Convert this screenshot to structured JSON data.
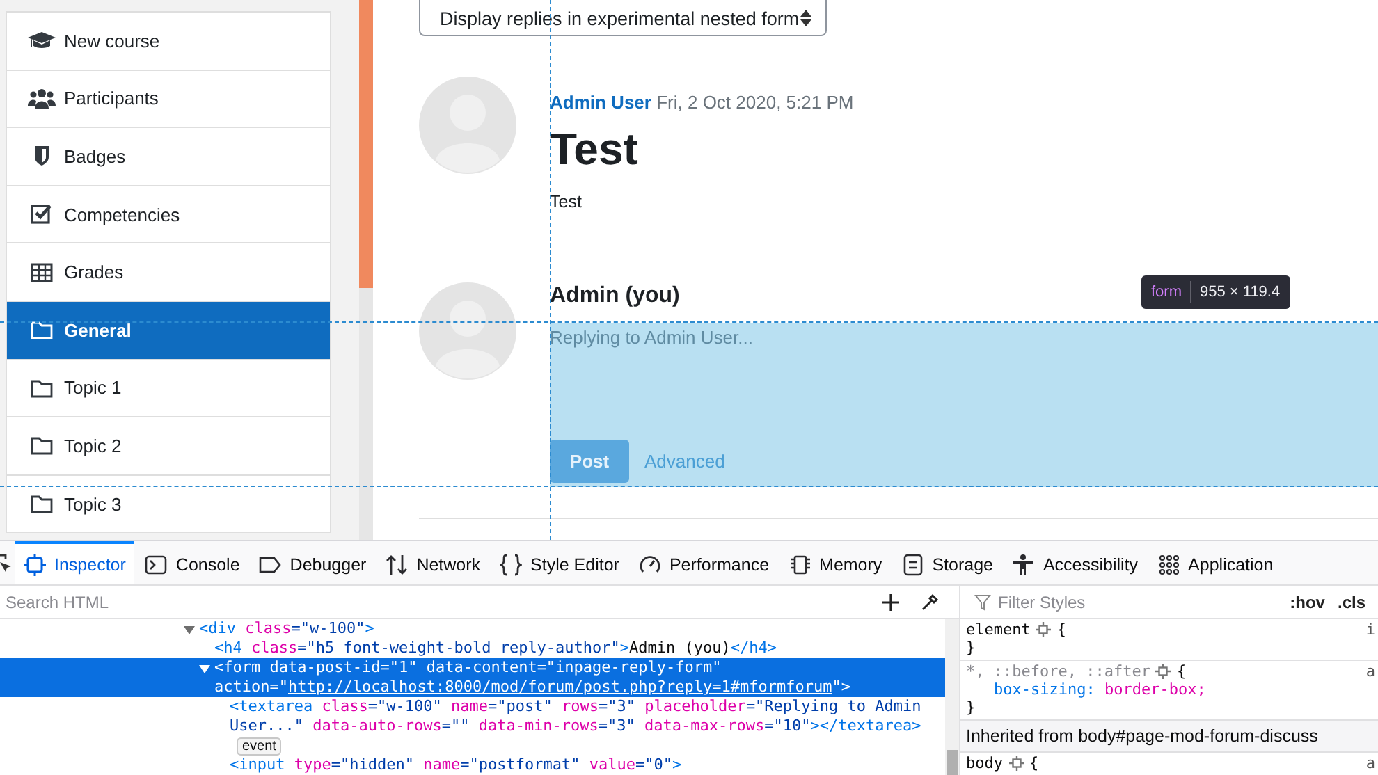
{
  "sidebar": {
    "items": [
      {
        "kind": "course",
        "label": "New course",
        "selected": false
      },
      {
        "kind": "participants",
        "label": "Participants",
        "selected": false
      },
      {
        "kind": "badges",
        "label": "Badges",
        "selected": false
      },
      {
        "kind": "competencies",
        "label": "Competencies",
        "selected": false
      },
      {
        "kind": "grades",
        "label": "Grades",
        "selected": false
      },
      {
        "kind": "section",
        "label": "General",
        "selected": true
      },
      {
        "kind": "section",
        "label": "Topic 1",
        "selected": false
      },
      {
        "kind": "section",
        "label": "Topic 2",
        "selected": false
      },
      {
        "kind": "section",
        "label": "Topic 3",
        "selected": false
      }
    ]
  },
  "display_mode": {
    "value": "Display replies in experimental nested form"
  },
  "post": {
    "author": "Admin User",
    "date": "Fri, 2 Oct 2020, 5:21 PM",
    "title": "Test",
    "body": "Test"
  },
  "reply": {
    "author": "Admin (you)",
    "placeholder": "Replying to Admin User...",
    "submit": "Post",
    "advanced": "Advanced"
  },
  "highlight_tooltip": {
    "tag": "form",
    "size": "955 × 119.4"
  },
  "devtools": {
    "tabs": [
      {
        "kind": "inspector",
        "label": "Inspector",
        "selected": true
      },
      {
        "kind": "console",
        "label": "Console",
        "selected": false
      },
      {
        "kind": "debugger",
        "label": "Debugger",
        "selected": false
      },
      {
        "kind": "network",
        "label": "Network",
        "selected": false
      },
      {
        "kind": "style",
        "label": "Style Editor",
        "selected": false
      },
      {
        "kind": "performance",
        "label": "Performance",
        "selected": false
      },
      {
        "kind": "memory",
        "label": "Memory",
        "selected": false
      },
      {
        "kind": "storage",
        "label": "Storage",
        "selected": false
      },
      {
        "kind": "accessibility",
        "label": "Accessibility",
        "selected": false
      },
      {
        "kind": "application",
        "label": "Application",
        "selected": false
      }
    ],
    "search": {
      "placeholder": "Search HTML"
    },
    "filter": {
      "placeholder": "Filter Styles"
    },
    "hov": ":hov",
    "cls": ".cls",
    "markup": {
      "nodes": [
        {
          "expanded": true,
          "selected": false,
          "lines": [
            [
              {
                "kind": "tag",
                "text": "<div"
              },
              {
                "kind": "attr",
                "text": " class"
              },
              {
                "kind": "value",
                "text": "=\"w-100\""
              },
              {
                "kind": "tag",
                "text": ">"
              }
            ]
          ],
          "children": [
            {
              "selected": false,
              "lines": [
                [
                  {
                    "kind": "tag",
                    "text": "<h4"
                  },
                  {
                    "kind": "attr",
                    "text": " class"
                  },
                  {
                    "kind": "value",
                    "text": "=\"h5 font-weight-bold reply-author\""
                  },
                  {
                    "kind": "tag",
                    "text": ">"
                  },
                  {
                    "kind": "text",
                    "text": "Admin (you)"
                  },
                  {
                    "kind": "tag",
                    "text": "</h4>"
                  }
                ]
              ]
            },
            {
              "expanded": true,
              "selected": true,
              "lines": [
                [
                  {
                    "kind": "tag",
                    "text": "<form"
                  },
                  {
                    "kind": "attr",
                    "text": " data-post-id"
                  },
                  {
                    "kind": "value",
                    "text": "=\"1\""
                  },
                  {
                    "kind": "attr",
                    "text": " data-content"
                  },
                  {
                    "kind": "value",
                    "text": "=\"inpage-reply-form\""
                  }
                ],
                [
                  {
                    "kind": "attr",
                    "text": "action"
                  },
                  {
                    "kind": "value",
                    "text": "=\""
                  },
                  {
                    "kind": "link",
                    "text": "http://localhost:8000/mod/forum/post.php?reply=1#mformforum"
                  },
                  {
                    "kind": "value",
                    "text": "\""
                  },
                  {
                    "kind": "tag",
                    "text": ">"
                  }
                ]
              ],
              "children": [
                {
                  "selected": false,
                  "badge": "event",
                  "lines": [
                    [
                      {
                        "kind": "tag",
                        "text": "<textarea"
                      },
                      {
                        "kind": "attr",
                        "text": " class"
                      },
                      {
                        "kind": "value",
                        "text": "=\"w-100\""
                      },
                      {
                        "kind": "attr",
                        "text": " name"
                      },
                      {
                        "kind": "value",
                        "text": "=\"post\""
                      },
                      {
                        "kind": "attr",
                        "text": " rows"
                      },
                      {
                        "kind": "value",
                        "text": "=\"3\""
                      },
                      {
                        "kind": "attr",
                        "text": " placeholder"
                      },
                      {
                        "kind": "value",
                        "text": "=\"Replying to Admin"
                      }
                    ],
                    [
                      {
                        "kind": "value",
                        "text": "User...\""
                      },
                      {
                        "kind": "attr",
                        "text": " data-auto-rows"
                      },
                      {
                        "kind": "value",
                        "text": "=\"\""
                      },
                      {
                        "kind": "attr",
                        "text": " data-min-rows"
                      },
                      {
                        "kind": "value",
                        "text": "=\"3\""
                      },
                      {
                        "kind": "attr",
                        "text": " data-max-rows"
                      },
                      {
                        "kind": "value",
                        "text": "=\"10\""
                      },
                      {
                        "kind": "tag",
                        "text": "></textarea>"
                      }
                    ]
                  ]
                },
                {
                  "selected": false,
                  "lines": [
                    [
                      {
                        "kind": "tag",
                        "text": "<input"
                      },
                      {
                        "kind": "attr",
                        "text": " type"
                      },
                      {
                        "kind": "value",
                        "text": "=\"hidden\""
                      },
                      {
                        "kind": "attr",
                        "text": " name"
                      },
                      {
                        "kind": "value",
                        "text": "=\"postformat\""
                      },
                      {
                        "kind": "attr",
                        "text": " value"
                      },
                      {
                        "kind": "value",
                        "text": "=\"0\""
                      },
                      {
                        "kind": "tag",
                        "text": ">"
                      }
                    ]
                  ]
                }
              ]
            }
          ]
        }
      ]
    },
    "rules": [
      {
        "kind": "rule",
        "selector": "element",
        "dim": false,
        "open": "{",
        "close": "}",
        "source": "i"
      },
      {
        "kind": "rule",
        "selector": "*, ::before, ::after",
        "dim": true,
        "open": "{",
        "close": "}",
        "source": "a",
        "declarations": [
          {
            "property": "box-sizing:",
            "value": "border-box;"
          }
        ]
      },
      {
        "kind": "header",
        "text": "Inherited from body#page-mod-forum-discuss"
      },
      {
        "kind": "rule",
        "selector": "body",
        "dim": false,
        "open": "{",
        "source": "a"
      }
    ]
  }
}
